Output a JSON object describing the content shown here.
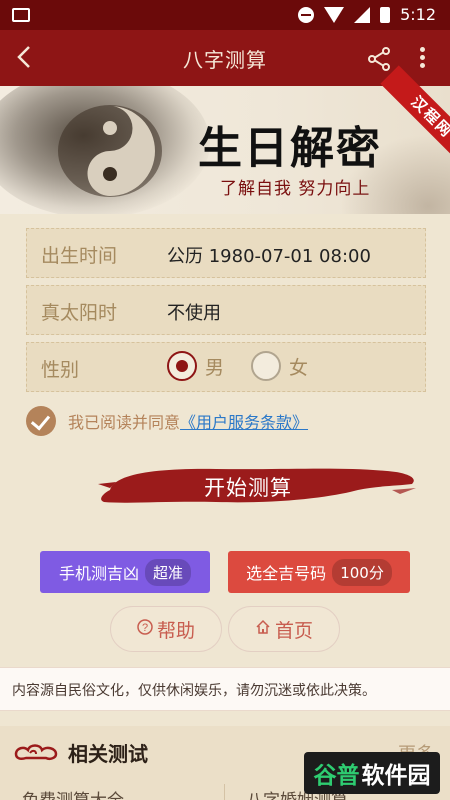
{
  "status_bar": {
    "time": "5:12",
    "icons": [
      "image-icon",
      "dnd-icon",
      "wifi-icon",
      "signal-icon",
      "battery-icon"
    ]
  },
  "topbar": {
    "title": "八字测算",
    "back_icon": "back-arrow-icon",
    "share_icon": "share-icon",
    "more_icon": "more-vert-icon",
    "bg": "#8e1515"
  },
  "banner": {
    "title": "生日解密",
    "slogan": "了解自我 努力向上",
    "ribbon": "汉程网"
  },
  "form": {
    "birth": {
      "label": "出生时间",
      "value": "公历 1980-07-01 08:00"
    },
    "solar": {
      "label": "真太阳时",
      "value": "不使用"
    },
    "gender": {
      "label": "性别",
      "options": [
        {
          "label": "男",
          "checked": true
        },
        {
          "label": "女",
          "checked": false
        }
      ]
    }
  },
  "agreement": {
    "text": "我已阅读并同意",
    "link": "《用户服务条款》",
    "checked": true
  },
  "start_button": {
    "label": "开始测算"
  },
  "promos": [
    {
      "label": "手机测吉凶",
      "badge": "超准",
      "color": "#7f5be3"
    },
    {
      "label": "选全吉号码",
      "badge": "100分",
      "color": "#dc4a3f"
    }
  ],
  "nav": {
    "help": "帮助",
    "home": "首页"
  },
  "disclaimer": "内容源自民俗文化，仅供休闲娱乐，请勿沉迷或依此决策。",
  "related": {
    "title": "相关测试",
    "more": "更多",
    "items": [
      "免费测算大全",
      "八字婚姻测算"
    ]
  },
  "watermark": {
    "part1": "谷普",
    "part2": "软件园"
  }
}
